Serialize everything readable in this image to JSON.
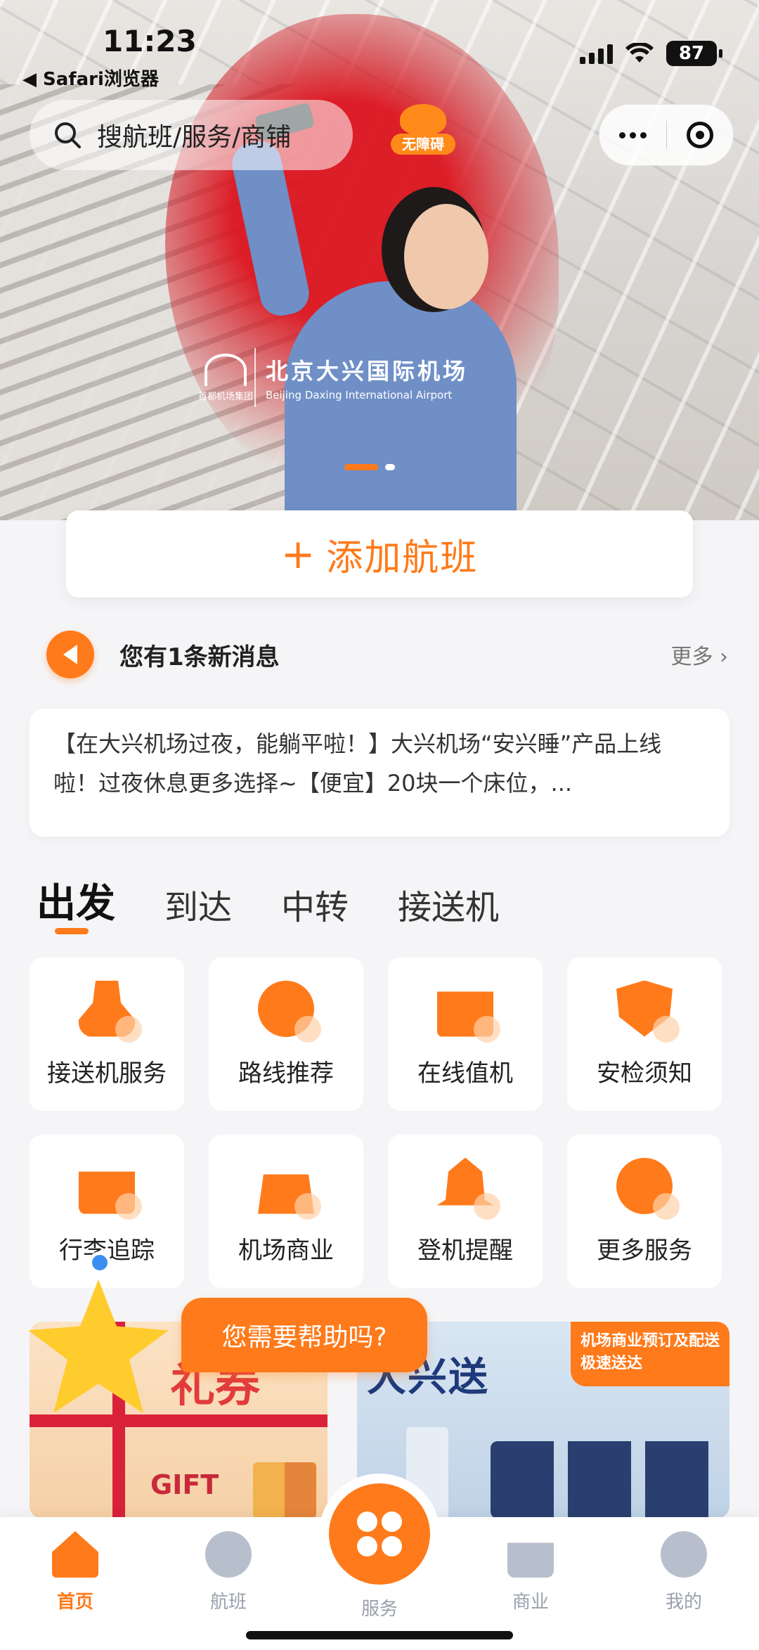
{
  "status": {
    "time": "11:23",
    "back_app": "◀ Safari浏览器",
    "battery": "87"
  },
  "topbar": {
    "search_placeholder": "搜航班/服务/商铺",
    "accessible_label": "无障碍"
  },
  "hero": {
    "group_caption": "首都机场集团",
    "airport_cn": "北京大兴国际机场",
    "airport_en": "Beijing Daxing International Airport",
    "slides_total": 2,
    "slide_active": 1
  },
  "add_flight": {
    "plus": "+",
    "label": "添加航班"
  },
  "notice": {
    "title": "您有1条新消息",
    "more": "更多 ›",
    "message": "【在大兴机场过夜，能躺平啦！】大兴机场“安兴睡”产品上线啦！过夜休息更多选择~【便宜】20块一个床位，..."
  },
  "tabs": [
    {
      "label": "出发",
      "active": true
    },
    {
      "label": "到达",
      "active": false
    },
    {
      "label": "中转",
      "active": false
    },
    {
      "label": "接送机",
      "active": false
    }
  ],
  "services": [
    {
      "label": "接送机服务",
      "icon": "pickup-person-icon"
    },
    {
      "label": "路线推荐",
      "icon": "route-icon"
    },
    {
      "label": "在线值机",
      "icon": "checkin-seat-icon"
    },
    {
      "label": "安检须知",
      "icon": "security-shield-icon"
    },
    {
      "label": "行李追踪",
      "icon": "baggage-icon"
    },
    {
      "label": "机场商业",
      "icon": "shopping-bag-icon"
    },
    {
      "label": "登机提醒",
      "icon": "bell-icon"
    },
    {
      "label": "更多服务",
      "icon": "more-dots-icon"
    }
  ],
  "promos": {
    "left_title": "礼券",
    "left_en": "GIFT",
    "right_title": "大兴送",
    "right_tag": "机场商业预订及配送极速送达"
  },
  "assistant": {
    "help_text": "您需要帮助吗?"
  },
  "tabbar": {
    "home": "首页",
    "flights": "航班",
    "services": "服务",
    "commerce": "商业",
    "me": "我的"
  },
  "colors": {
    "accent": "#ff7a1a",
    "background": "#f5f5f7",
    "inactive": "#9aa1ad"
  }
}
